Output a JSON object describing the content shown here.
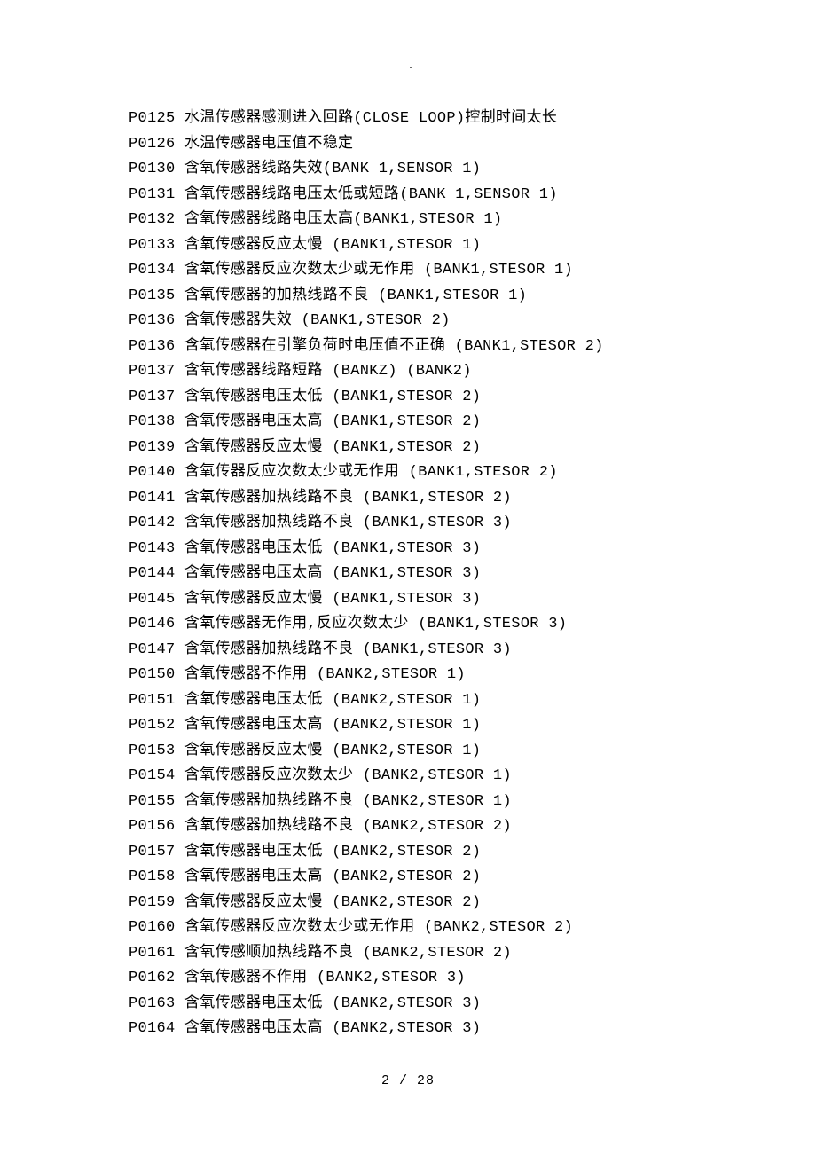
{
  "topMark": ".",
  "lines": [
    "P0125 水温传感器感测进入回路(CLOSE LOOP)控制时间太长",
    "P0126 水温传感器电压值不稳定",
    "P0130 含氧传感器线路失效(BANK 1,SENSOR 1)",
    "P0131 含氧传感器线路电压太低或短路(BANK 1,SENSOR 1)",
    "P0132 含氧传感器线路电压太高(BANK1,STESOR 1)",
    "P0133 含氧传感器反应太慢 (BANK1,STESOR 1)",
    "P0134 含氧传感器反应次数太少或无作用 (BANK1,STESOR 1)",
    "P0135 含氧传感器的加热线路不良 (BANK1,STESOR 1)",
    "P0136 含氧传感器失效 (BANK1,STESOR 2)",
    "P0136 含氧传感器在引擎负荷时电压值不正确 (BANK1,STESOR 2)",
    "P0137 含氧传感器线路短路 (BANKZ) (BANK2)",
    "P0137 含氧传感器电压太低 (BANK1,STESOR 2)",
    "P0138 含氧传感器电压太高 (BANK1,STESOR 2)",
    "P0139 含氧传感器反应太慢 (BANK1,STESOR 2)",
    "P0140 含氧传器反应次数太少或无作用 (BANK1,STESOR 2)",
    "P0141 含氧传感器加热线路不良 (BANK1,STESOR 2)",
    "P0142 含氧传感器加热线路不良 (BANK1,STESOR 3)",
    "P0143 含氧传感器电压太低 (BANK1,STESOR 3)",
    "P0144 含氧传感器电压太高 (BANK1,STESOR 3)",
    "P0145 含氧传感器反应太慢 (BANK1,STESOR 3)",
    "P0146 含氧传感器无作用,反应次数太少 (BANK1,STESOR 3)",
    "P0147 含氧传感器加热线路不良 (BANK1,STESOR 3)",
    "P0150 含氧传感器不作用 (BANK2,STESOR 1)",
    "P0151 含氧传感器电压太低 (BANK2,STESOR 1)",
    "P0152 含氧传感器电压太高 (BANK2,STESOR 1)",
    "P0153 含氧传感器反应太慢 (BANK2,STESOR 1)",
    "P0154 含氧传感器反应次数太少 (BANK2,STESOR 1)",
    "P0155 含氧传感器加热线路不良 (BANK2,STESOR 1)",
    "P0156 含氧传感器加热线路不良 (BANK2,STESOR 2)",
    "P0157 含氧传感器电压太低 (BANK2,STESOR 2)",
    "P0158 含氧传感器电压太高 (BANK2,STESOR 2)",
    "P0159 含氧传感器反应太慢 (BANK2,STESOR 2)",
    "P0160 含氧传感器反应次数太少或无作用 (BANK2,STESOR 2)",
    "P0161 含氧传感顺加热线路不良 (BANK2,STESOR 2)",
    "P0162 含氧传感器不作用 (BANK2,STESOR 3)",
    "P0163 含氧传感器电压太低 (BANK2,STESOR 3)",
    "P0164 含氧传感器电压太高 (BANK2,STESOR 3)"
  ],
  "pageNumber": "2 / 28"
}
